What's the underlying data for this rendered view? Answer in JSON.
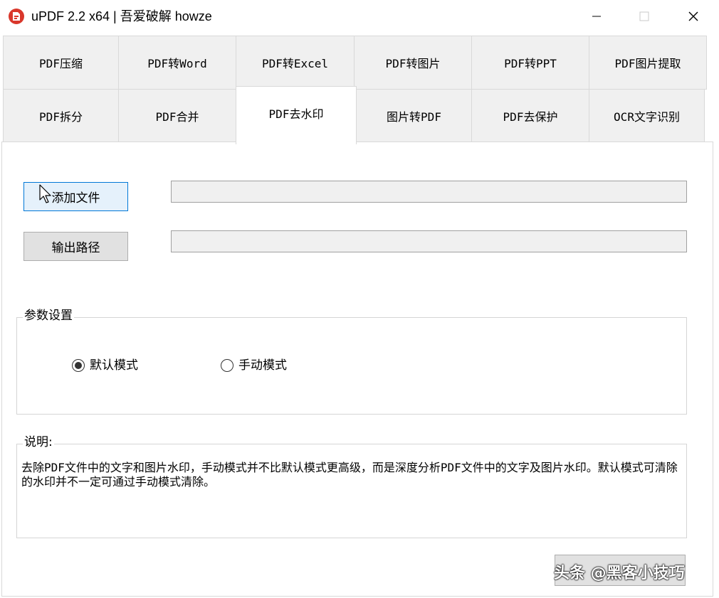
{
  "window": {
    "title": "uPDF 2.2 x64 | 吾爱破解 howze",
    "icons": {
      "app": "pdf-app-icon",
      "minimize": "minimize-icon",
      "maximize": "maximize-icon",
      "close": "close-icon"
    }
  },
  "tabs": {
    "row1": [
      "PDF压缩",
      "PDF转Word",
      "PDF转Excel",
      "PDF转图片",
      "PDF转PPT",
      "PDF图片提取"
    ],
    "row2": [
      "PDF拆分",
      "PDF合并",
      "PDF去水印",
      "图片转PDF",
      "PDF去保护",
      "OCR文字识别"
    ],
    "active": "PDF去水印"
  },
  "main": {
    "add_file_button": "添加文件",
    "add_file_value": "",
    "output_path_button": "输出路径",
    "output_path_value": ""
  },
  "params": {
    "legend": "参数设置",
    "default_mode": "默认模式",
    "manual_mode": "手动模式",
    "selected": "默认模式"
  },
  "description": {
    "legend": "说明:",
    "text": "去除PDF文件中的文字和图片水印，手动模式并不比默认模式更高级，而是深度分析PDF文件中的文字及图片水印。默认模式可清除的水印并不一定可通过手动模式清除。"
  },
  "watermark_overlay": "头条 @黑客小技巧"
}
